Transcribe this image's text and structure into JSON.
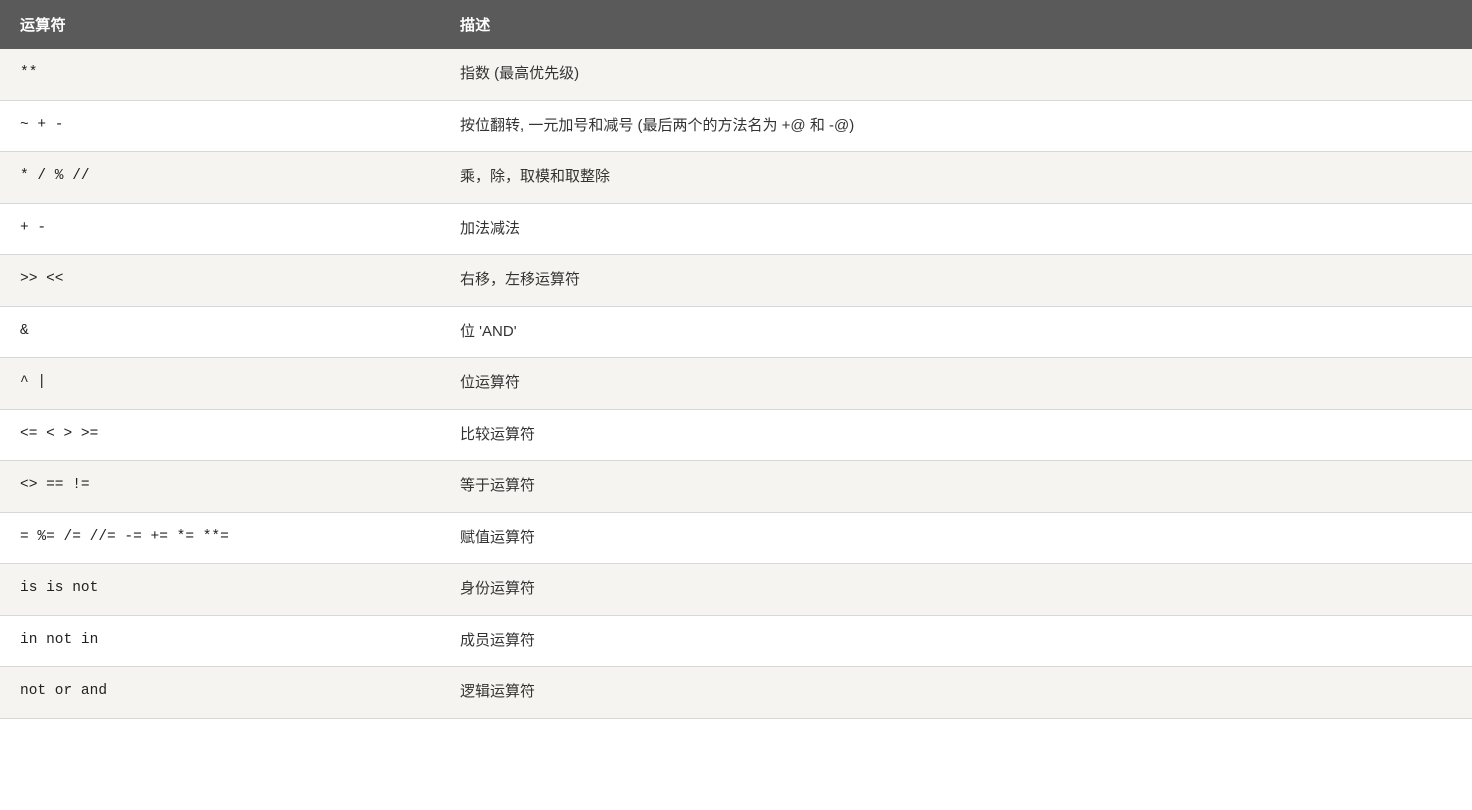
{
  "table": {
    "headers": [
      {
        "id": "col-operator",
        "label": "运算符"
      },
      {
        "id": "col-description",
        "label": "描述"
      }
    ],
    "rows": [
      {
        "operator": "**",
        "description": "指数 (最高优先级)"
      },
      {
        "operator": "~ + -",
        "description": "按位翻转, 一元加号和减号 (最后两个的方法名为 +@ 和 -@)"
      },
      {
        "operator": "* / % //",
        "description": "乘，除，取模和取整除"
      },
      {
        "operator": "+ -",
        "description": "加法减法"
      },
      {
        "operator": ">> <<",
        "description": "右移，左移运算符"
      },
      {
        "operator": "&",
        "description": "位 'AND'"
      },
      {
        "operator": "^ |",
        "description": "位运算符"
      },
      {
        "operator": "<= < > >=",
        "description": "比较运算符"
      },
      {
        "operator": "<> == !=",
        "description": "等于运算符"
      },
      {
        "operator": "= %= /= //= -= += *= **=",
        "description": "赋值运算符"
      },
      {
        "operator": "is  is not",
        "description": "身份运算符"
      },
      {
        "operator": "in  not in",
        "description": "成员运算符"
      },
      {
        "operator": "not  or  and",
        "description": "逻辑运算符"
      }
    ]
  }
}
